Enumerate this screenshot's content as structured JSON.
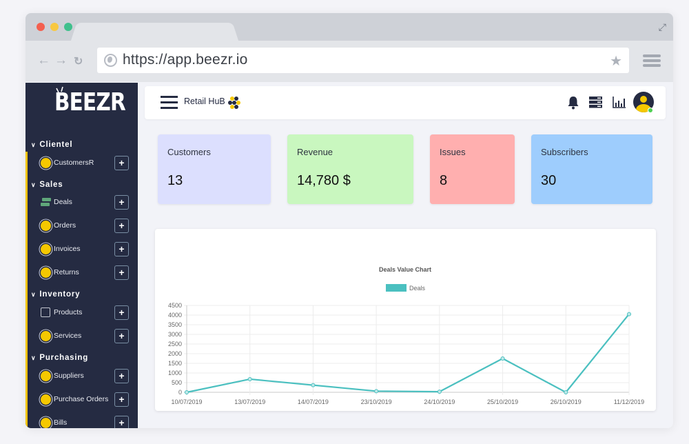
{
  "browser": {
    "url": "https://app.beezr.io",
    "traffic_lights": [
      "#f4604f",
      "#f8c841",
      "#3fc08c"
    ]
  },
  "sidebar": {
    "logo": "BEEZR",
    "sections": [
      {
        "title": "Clientel",
        "items": [
          {
            "label": "CustomersR",
            "icon": "coin-icon"
          }
        ]
      },
      {
        "title": "Sales",
        "items": [
          {
            "label": "Deals",
            "icon": "money-icon"
          },
          {
            "label": "Orders",
            "icon": "coin-icon"
          },
          {
            "label": "Invoices",
            "icon": "coin-icon"
          },
          {
            "label": "Returns",
            "icon": "coin-icon"
          }
        ]
      },
      {
        "title": "Inventory",
        "items": [
          {
            "label": "Products",
            "icon": "box-icon"
          },
          {
            "label": "Services",
            "icon": "coin-icon"
          }
        ]
      },
      {
        "title": "Purchasing",
        "items": [
          {
            "label": "Suppliers",
            "icon": "coin-icon"
          },
          {
            "label": "Purchase Orders",
            "icon": "coin-icon"
          },
          {
            "label": "Bills",
            "icon": "coin-icon"
          }
        ]
      }
    ],
    "add_label": "+"
  },
  "topbar": {
    "title": "Retail HuB"
  },
  "stats": [
    {
      "title": "Customers",
      "value": "13",
      "color": "#dcdffe"
    },
    {
      "title": "Revenue",
      "value": "14,780 $",
      "color": "#c9f7bf"
    },
    {
      "title": "Issues",
      "value": "8",
      "color": "#ffafaf"
    },
    {
      "title": "Subscribers",
      "value": "30",
      "color": "#9ecdfd"
    }
  ],
  "chart_data": {
    "type": "line",
    "title": "Deals Value Chart",
    "categories": [
      "10/07/2019",
      "13/07/2019",
      "14/07/2019",
      "23/10/2019",
      "24/10/2019",
      "25/10/2019",
      "26/10/2019",
      "11/12/2019"
    ],
    "series": [
      {
        "name": "Deals",
        "color": "#4bc0c0",
        "values": [
          0,
          680,
          370,
          60,
          30,
          1750,
          0,
          4050
        ]
      }
    ],
    "yticks": [
      0,
      500,
      1000,
      1500,
      2000,
      2500,
      3000,
      3500,
      4000,
      4500
    ],
    "ylim": [
      0,
      4500
    ],
    "xlabel": "",
    "ylabel": "",
    "grid": true,
    "legend": "top"
  }
}
